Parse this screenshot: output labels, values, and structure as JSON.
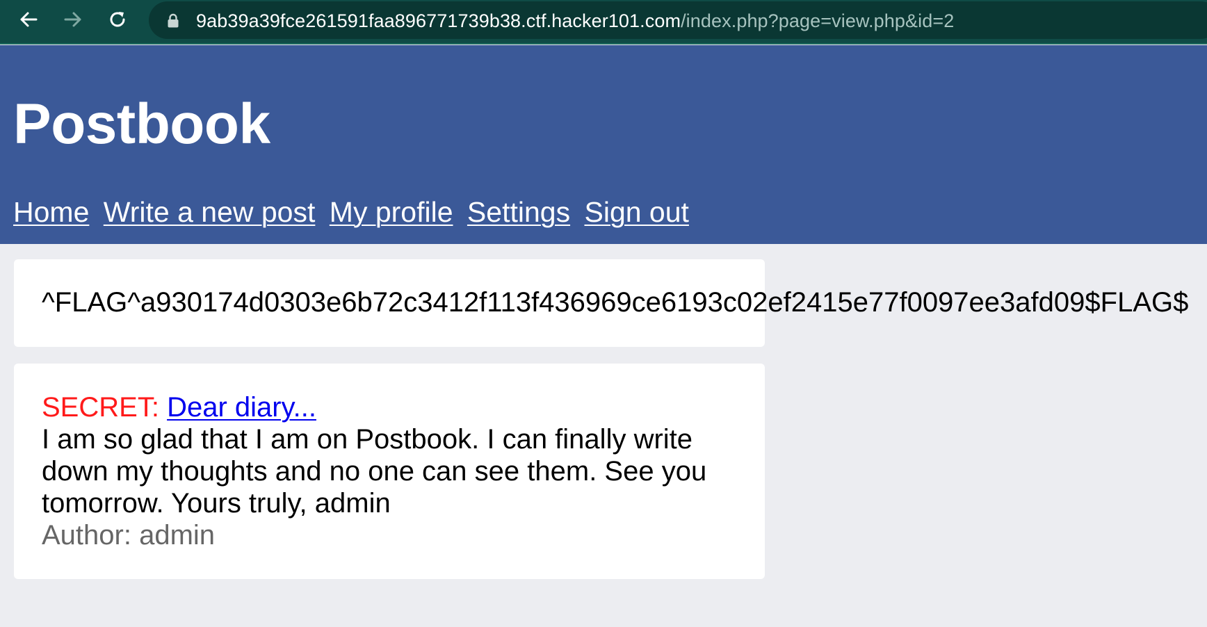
{
  "browser": {
    "url_host": "9ab39a39fce261591faa896771739b38.ctf.hacker101.com",
    "url_path": "/index.php?page=view.php&id=2"
  },
  "site": {
    "title": "Postbook",
    "nav": [
      {
        "label": "Home"
      },
      {
        "label": "Write a new post"
      },
      {
        "label": "My profile"
      },
      {
        "label": "Settings"
      },
      {
        "label": "Sign out"
      }
    ]
  },
  "flag_card": {
    "text": "^FLAG^a930174d0303e6b72c3412f113f436969ce6193c02ef2415e77f0097ee3afd09$FLAG$"
  },
  "post": {
    "secret_label": "SECRET:",
    "title": "Dear diary...",
    "body": "I am so glad that I am on Postbook. I can finally write down my thoughts and no one can see them. See you tomorrow. Yours truly, admin",
    "author": "Author: admin"
  },
  "colors": {
    "header_blue": "#3b5998",
    "browser_bar": "#0f4b46",
    "secret_red": "#ff1a1a",
    "link_blue": "#0000ee"
  },
  "icons": [
    "back-arrow-icon",
    "forward-arrow-icon",
    "reload-icon",
    "lock-icon"
  ]
}
